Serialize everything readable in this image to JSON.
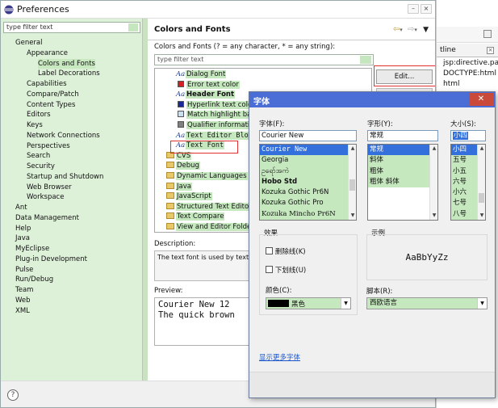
{
  "window": {
    "title": "Preferences"
  },
  "left": {
    "filter_placeholder": "type filter text",
    "tree": [
      {
        "label": "General",
        "indent": 0
      },
      {
        "label": "Appearance",
        "indent": 1
      },
      {
        "label": "Colors and Fonts",
        "indent": 2,
        "selected": true
      },
      {
        "label": "Label Decorations",
        "indent": 2
      },
      {
        "label": "Capabilities",
        "indent": 1
      },
      {
        "label": "Compare/Patch",
        "indent": 1
      },
      {
        "label": "Content Types",
        "indent": 1
      },
      {
        "label": "Editors",
        "indent": 1
      },
      {
        "label": "Keys",
        "indent": 1
      },
      {
        "label": "Network Connections",
        "indent": 1
      },
      {
        "label": "Perspectives",
        "indent": 1
      },
      {
        "label": "Search",
        "indent": 1
      },
      {
        "label": "Security",
        "indent": 1
      },
      {
        "label": "Startup and Shutdown",
        "indent": 1
      },
      {
        "label": "Web Browser",
        "indent": 1
      },
      {
        "label": "Workspace",
        "indent": 1
      },
      {
        "label": "Ant",
        "indent": 0
      },
      {
        "label": "Data Management",
        "indent": 0
      },
      {
        "label": "Help",
        "indent": 0
      },
      {
        "label": "Java",
        "indent": 0
      },
      {
        "label": "MyEclipse",
        "indent": 0
      },
      {
        "label": "Plug-in Development",
        "indent": 0
      },
      {
        "label": "Pulse",
        "indent": 0
      },
      {
        "label": "Run/Debug",
        "indent": 0
      },
      {
        "label": "Team",
        "indent": 0
      },
      {
        "label": "Web",
        "indent": 0
      },
      {
        "label": "XML",
        "indent": 0
      }
    ]
  },
  "right": {
    "title": "Colors and Fonts",
    "subtitle": "Colors and Fonts (? = any character, * = any string):",
    "filter_placeholder": "type filter text",
    "items": [
      {
        "icon": "aa",
        "label": "Dialog Font",
        "indent": 1
      },
      {
        "icon": "swatch",
        "color": "#d42020",
        "label": "Error text color",
        "indent": 1
      },
      {
        "icon": "aa",
        "label": "Header Font",
        "bold": true,
        "indent": 1
      },
      {
        "icon": "swatch",
        "color": "#1a2a9a",
        "label": "Hyperlink text color",
        "indent": 1
      },
      {
        "icon": "swatch",
        "color": "#c8e0f0",
        "label": "Match highlight back",
        "indent": 1
      },
      {
        "icon": "swatch",
        "color": "#808080",
        "label": "Qualifier information",
        "indent": 1
      },
      {
        "icon": "aa",
        "label": "Text Editor Blo",
        "mono": true,
        "indent": 1
      },
      {
        "icon": "aa",
        "label": "Text Font",
        "mono": true,
        "indent": 1
      },
      {
        "icon": "folder",
        "label": "CVS",
        "indent": 0
      },
      {
        "icon": "folder",
        "label": "Debug",
        "indent": 0
      },
      {
        "icon": "folder",
        "label": "Dynamic Languages",
        "indent": 0
      },
      {
        "icon": "folder",
        "label": "Java",
        "indent": 0
      },
      {
        "icon": "folder",
        "label": "JavaScript",
        "indent": 0
      },
      {
        "icon": "folder",
        "label": "Structured Text Editors",
        "indent": 0
      },
      {
        "icon": "folder",
        "label": "Text Compare",
        "indent": 0
      },
      {
        "icon": "folder",
        "label": "View and Editor Folders",
        "indent": 0
      }
    ],
    "edit_button": "Edit...",
    "description_label": "Description:",
    "description_text": "The text font is used by text ed",
    "preview_label": "Preview:",
    "preview_lines": [
      "Courier New 12",
      "The quick brown"
    ]
  },
  "ide": {
    "tab_label": "tline",
    "lines": [
      "jsp:directive.page",
      "DOCTYPE:html",
      "html"
    ]
  },
  "dialog": {
    "title": "字体",
    "font_label": "字体(F):",
    "font_value": "Courier New",
    "fonts": [
      "Courier New",
      "Georgia",
      "ဥရော်အကဲ",
      "Hobo Std",
      "Kozuka Gothic Pr6N",
      "Kozuka Gothic Pro",
      "Kozuka Mincho Pr6N"
    ],
    "style_label": "字形(Y):",
    "style_value": "常规",
    "styles": [
      "常规",
      "斜体",
      "粗体",
      "粗体 斜体"
    ],
    "size_label": "大小(S):",
    "size_value": "小四",
    "sizes": [
      "小四",
      "五号",
      "小五",
      "六号",
      "小六",
      "七号",
      "八号"
    ],
    "effects_label": "效果",
    "strike_label": "删除线(K)",
    "underline_label": "下划线(U)",
    "color_label": "颜色(C):",
    "color_value": "黑色",
    "sample_label": "示例",
    "sample_text": "AaBbYyZz",
    "script_label": "脚本(R):",
    "script_value": "西欧语言",
    "more_fonts_link": "显示更多字体"
  }
}
